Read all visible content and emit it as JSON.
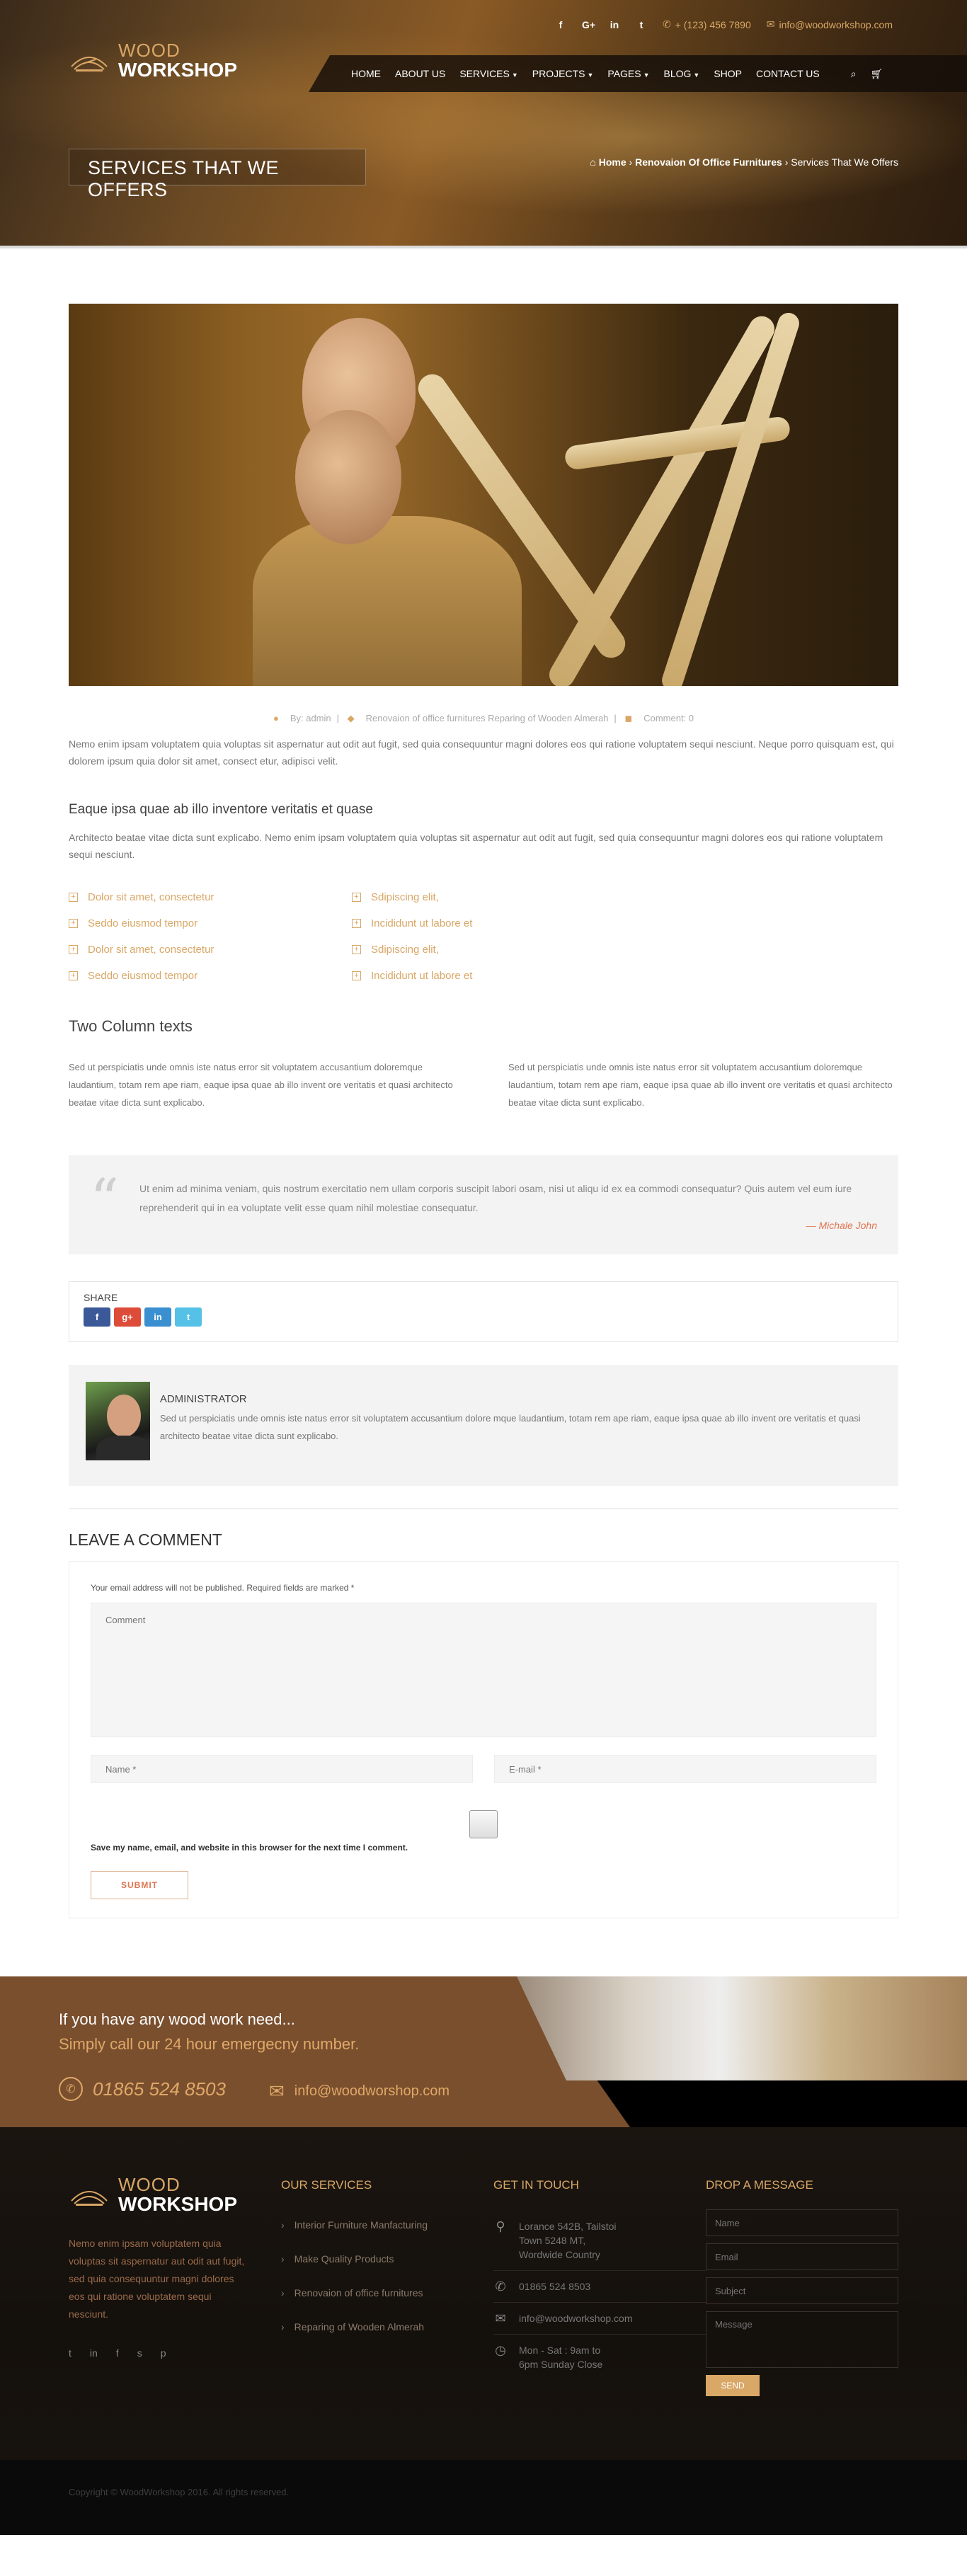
{
  "header": {
    "social": [
      "f",
      "G+",
      "in",
      "t"
    ],
    "phone": "+ (123) 456 7890",
    "email": "info@woodworkshop.com",
    "logo_line1": "WOOD",
    "logo_line2": "WORKSHOP",
    "nav": [
      {
        "label": "HOME",
        "dropdown": false
      },
      {
        "label": "ABOUT US",
        "dropdown": false
      },
      {
        "label": "SERVICES",
        "dropdown": true
      },
      {
        "label": "PROJECTS",
        "dropdown": true
      },
      {
        "label": "PAGES",
        "dropdown": true
      },
      {
        "label": "BLOG",
        "dropdown": true
      },
      {
        "label": "SHOP",
        "dropdown": false
      },
      {
        "label": "CONTACT US",
        "dropdown": false
      }
    ],
    "banner_title": "SERVICES THAT WE OFFERS",
    "breadcrumb": {
      "home": "Home",
      "sep": "›",
      "parent": "Renovaion Of Office Furnitures",
      "current": "Services That We Offers"
    }
  },
  "post": {
    "meta_author": "By: admin",
    "meta_tags": "Renovaion of office furnitures  Reparing of Wooden Almerah",
    "meta_comments": "Comment: 0",
    "intro": "Nemo enim ipsam voluptatem quia voluptas sit aspernatur aut odit aut fugit, sed quia consequuntur magni dolores eos qui ratione voluptatem sequi nesciunt. Neque porro quisquam est, qui dolorem ipsum quia dolor sit amet, consect etur, adipisci velit.",
    "subheading": "Eaque ipsa quae ab illo inventore veritatis et quase",
    "subtext": "Architecto beatae vitae dicta sunt explicabo. Nemo enim ipsam voluptatem quia voluptas sit aspernatur aut odit aut fugit, sed quia consequuntur magni dolores eos qui ratione voluptatem sequi nesciunt.",
    "checklist": [
      "Dolor sit amet, consectetur",
      "Sdipiscing elit,",
      "Seddo eiusmod tempor",
      "Incididunt ut labore et",
      "Dolor sit amet, consectetur",
      "Sdipiscing elit,",
      "Seddo eiusmod tempor",
      "Incididunt ut labore et"
    ],
    "two_col_title": "Two Column texts",
    "col1": "Sed ut perspiciatis unde omnis iste natus error sit voluptatem accusantium doloremque laudantium, totam rem ape riam, eaque ipsa quae ab illo invent ore veritatis et quasi architecto beatae vitae dicta sunt explicabo.",
    "col2": "Sed ut perspiciatis unde omnis iste natus error sit voluptatem accusantium doloremque laudantium, totam rem ape riam, eaque ipsa quae ab illo invent ore veritatis et quasi architecto beatae vitae dicta sunt explicabo.",
    "quote": "Ut enim ad minima veniam, quis nostrum exercitatio nem ullam corporis suscipit labori osam, nisi ut aliqu id ex ea commodi consequatur? Quis autem vel eum iure reprehenderit qui in ea voluptate velit esse quam nihil molestiae consequatur.",
    "quote_author": "— Michale John",
    "share_label": "SHARE",
    "share_buttons": [
      {
        "label": "f",
        "color": "#3b5998"
      },
      {
        "label": "g+",
        "color": "#dd4b39"
      },
      {
        "label": "in",
        "color": "#3a8fd0"
      },
      {
        "label": "t",
        "color": "#55c1e7"
      }
    ],
    "author_name": "ADMINISTRATOR",
    "author_bio": "Sed ut perspiciatis unde omnis iste natus error sit voluptatem accusantium dolore mque laudantium, totam rem ape riam, eaque ipsa quae ab illo invent ore veritatis et quasi architecto beatae vitae dicta sunt explicabo."
  },
  "comment": {
    "title": "LEAVE A COMMENT",
    "note": "Your email address will not be published. Required fields are marked *",
    "comment_placeholder": "Comment",
    "name_placeholder": "Name *",
    "email_placeholder": "E-mail *",
    "save_label": "Save my name, email, and website in this browser for the next time I comment.",
    "submit": "SUBMIT"
  },
  "cta": {
    "line1": "If you have any wood work need...",
    "line2": "Simply call our 24 hour emergecny number.",
    "phone": "01865 524 8503",
    "email": "info@woodworshop.com"
  },
  "footer": {
    "logo_line1": "WOOD",
    "logo_line2": "WORKSHOP",
    "desc": "Nemo enim ipsam voluptatem quia voluptas sit aspernatur aut odit aut fugit, sed quia consequuntur magni dolores eos qui ratione voluptatem sequi nesciunt.",
    "social": [
      "t",
      "in",
      "f",
      "s",
      "p"
    ],
    "services_title": "OUR SERVICES",
    "services": [
      "Interior Furniture Manfacturing",
      "Make Quality Products",
      "Renovaion of office furnitures",
      "Reparing of Wooden Almerah"
    ],
    "touch_title": "GET IN TOUCH",
    "address": "Lorance 542B, Tailstoi Town 5248 MT, Wordwide Country",
    "phone": "01865 524 8503",
    "email": "info@woodworkshop.com",
    "hours": "Mon - Sat : 9am to 6pm Sunday Close",
    "drop_title": "DROP A MESSAGE",
    "form_name": "Name",
    "form_email": "Email",
    "form_subject": "Subject",
    "form_message": "Message",
    "send": "SEND",
    "copyright": "Copyright © WoodWorkshop 2016. All rights reserved."
  }
}
